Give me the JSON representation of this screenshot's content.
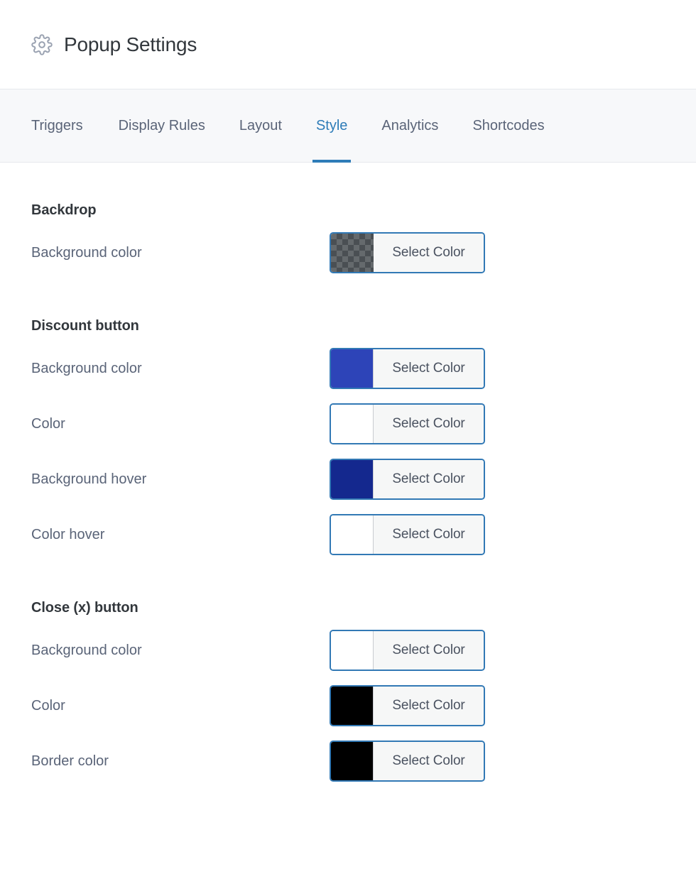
{
  "header": {
    "icon": "gear-icon",
    "title": "Popup Settings"
  },
  "tabs": [
    {
      "label": "Triggers",
      "active": false
    },
    {
      "label": "Display Rules",
      "active": false
    },
    {
      "label": "Layout",
      "active": false
    },
    {
      "label": "Style",
      "active": true
    },
    {
      "label": "Analytics",
      "active": false
    },
    {
      "label": "Shortcodes",
      "active": false
    }
  ],
  "button_label": "Select Color",
  "sections": [
    {
      "title": "Backdrop",
      "rows": [
        {
          "label": "Background color",
          "swatch": "transparent",
          "swatch_color": ""
        }
      ]
    },
    {
      "title": "Discount button",
      "rows": [
        {
          "label": "Background color",
          "swatch": "solid",
          "swatch_color": "#2d44b8"
        },
        {
          "label": "Color",
          "swatch": "solid",
          "swatch_color": "#ffffff"
        },
        {
          "label": "Background hover",
          "swatch": "solid",
          "swatch_color": "#14288e"
        },
        {
          "label": "Color hover",
          "swatch": "solid",
          "swatch_color": "#ffffff"
        }
      ]
    },
    {
      "title": "Close (x) button",
      "rows": [
        {
          "label": "Background color",
          "swatch": "solid",
          "swatch_color": "#ffffff"
        },
        {
          "label": "Color",
          "swatch": "solid",
          "swatch_color": "#000000"
        },
        {
          "label": "Border color",
          "swatch": "solid",
          "swatch_color": "#000000"
        }
      ]
    }
  ],
  "theme": {
    "accent": "#2e7cb8",
    "button_border": "#3279b5",
    "label_text": "#5a6478",
    "heading_text": "#32373c",
    "tabbar_bg": "#f7f8fa",
    "button_face": "#f6f7f7"
  }
}
